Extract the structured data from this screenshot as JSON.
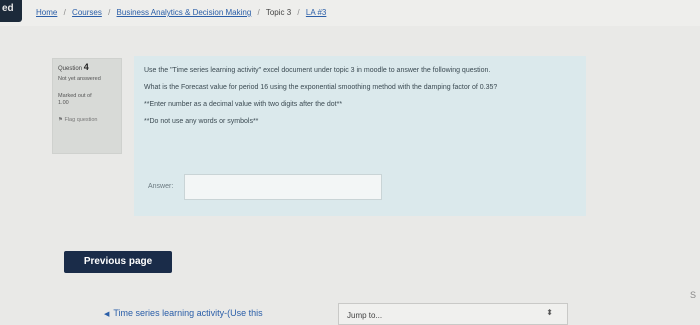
{
  "corner_tab": "ed",
  "breadcrumb": {
    "home": "Home",
    "courses": "Courses",
    "course": "Business Analytics & Decision Making",
    "topic": "Topic 3",
    "activity": "LA #3",
    "separator": "/"
  },
  "question_info": {
    "question_label": "Question",
    "question_number": "4",
    "status": "Not yet answered",
    "marked": "Marked out of",
    "marks": "1.00",
    "flag_label": "Flag question"
  },
  "question": {
    "line1": "Use the \"Time series learning activity\" excel document under topic 3 in moodle to answer the following question.",
    "line2": "What is the Forecast value for period 16 using the exponential smoothing method with the damping factor of 0.35?",
    "line3": "**Enter number as a decimal value with two digits after the dot**",
    "line4": "**Do not use any words or symbols**"
  },
  "answer": {
    "label": "Answer:",
    "value": ""
  },
  "buttons": {
    "previous": "Previous page"
  },
  "nav": {
    "activity_link": "Time series learning activity-(Use this",
    "jump_label": "Jump to...",
    "edge_letter": "S"
  },
  "colors": {
    "nav_dark": "#1a2c49",
    "question_bg": "#dbe9ec",
    "link": "#2a5ea8"
  }
}
